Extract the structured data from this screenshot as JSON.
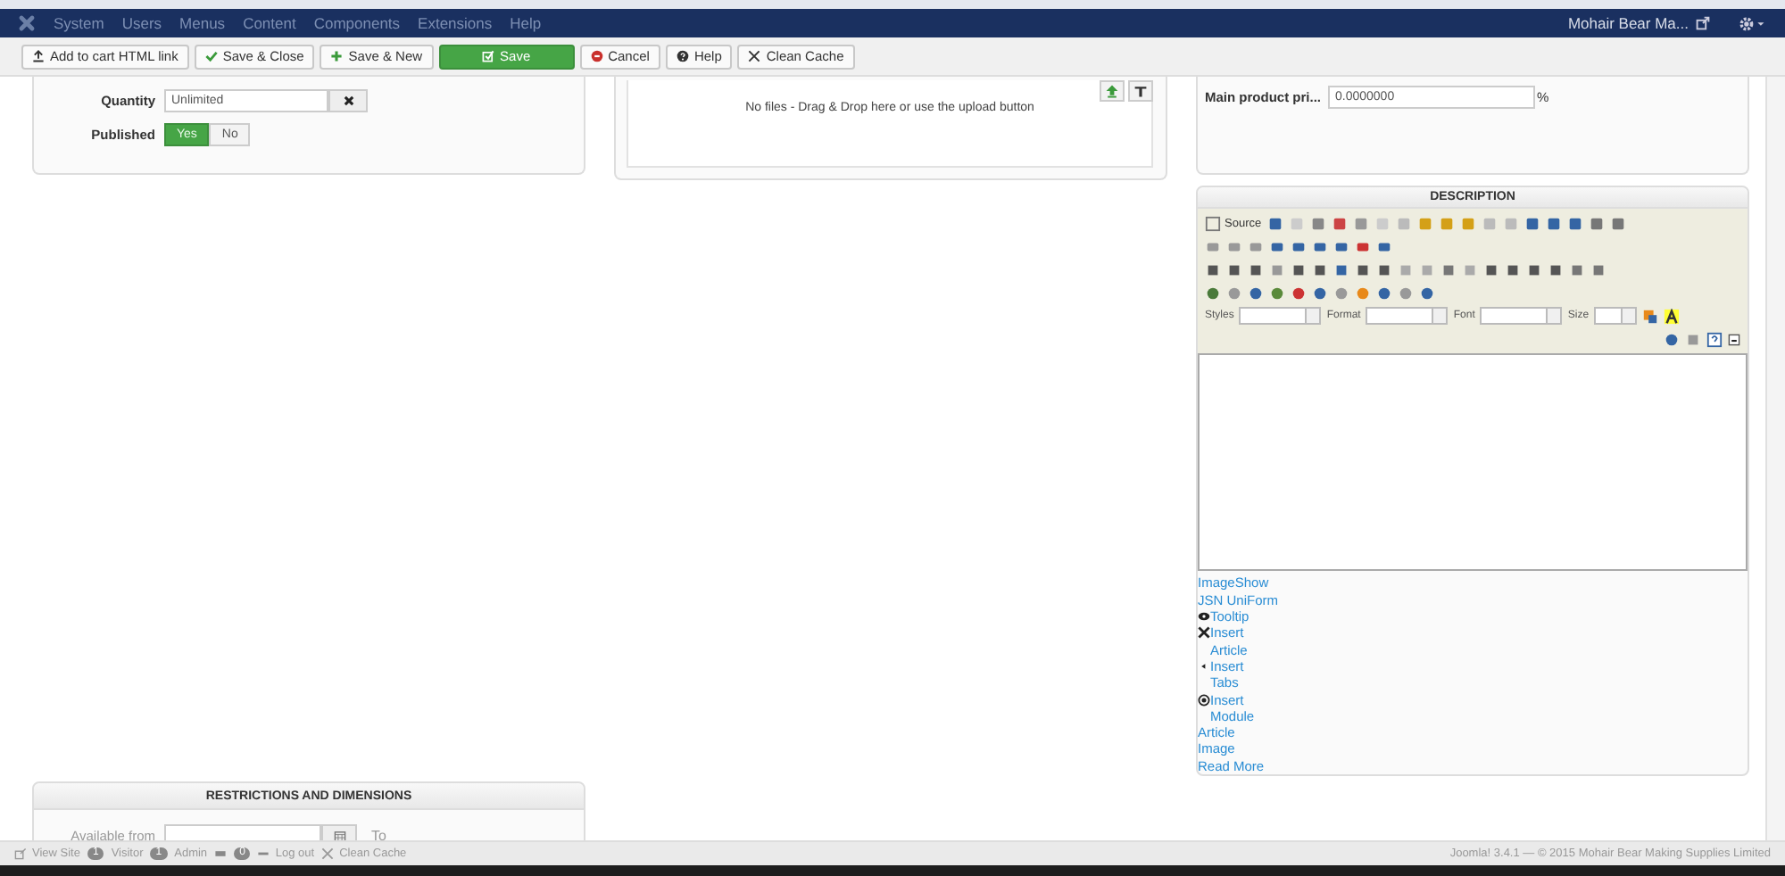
{
  "nav": {
    "menu": [
      "System",
      "Users",
      "Menus",
      "Content",
      "Components",
      "Extensions",
      "Help"
    ],
    "site": "Mohair Bear Ma..."
  },
  "toolbar": [
    {
      "label": "Add to cart HTML link",
      "kind": "upload"
    },
    {
      "label": "Save & Close",
      "kind": "check"
    },
    {
      "label": "Save & New",
      "kind": "plus"
    },
    {
      "label": "Save",
      "kind": "primary"
    },
    {
      "label": "Cancel",
      "kind": "cancel"
    },
    {
      "label": "Help",
      "kind": "help"
    },
    {
      "label": "Clean Cache",
      "kind": "clean"
    }
  ],
  "left_panel": {
    "quantity_label": "Quantity",
    "quantity_value": "Unlimited",
    "published_label": "Published",
    "published_options": [
      {
        "label": "Yes",
        "selected": true
      },
      {
        "label": "No",
        "selected": false
      }
    ]
  },
  "files_panel": {
    "message": "No files - Drag & Drop here or use the upload button"
  },
  "price_panel": {
    "label": "Main product pri...",
    "value": "0.0000000",
    "unit": "%"
  },
  "description": {
    "title": "DESCRIPTION",
    "toolbar": {
      "source": "Source",
      "styles": "Styles",
      "format": "Format",
      "font": "Font",
      "size": "Size"
    },
    "links": [
      {
        "label": "ImageShow",
        "kind": "plain"
      },
      {
        "label": "JSN UniForm",
        "kind": "plain"
      },
      {
        "label": "Tooltip",
        "kind": "eye"
      },
      {
        "label": "Insert Article",
        "kind": "cross"
      },
      {
        "label": "Insert Tabs",
        "kind": "bullet"
      },
      {
        "label": "Insert Module",
        "kind": "target"
      },
      {
        "label": "Article",
        "kind": "plain"
      },
      {
        "label": "Image",
        "kind": "plain"
      },
      {
        "label": "Read More",
        "kind": "plain"
      }
    ]
  },
  "restrictions": {
    "title": "RESTRICTIONS AND DIMENSIONS",
    "available_from": "Available from",
    "to": "To"
  },
  "status_bar": {
    "view_site": "View Site",
    "visitors": "1",
    "visitors_label": "Visitor",
    "admins": "1",
    "admins_label": "Admin",
    "messages": "0",
    "logout": "Log out",
    "clean_cache": "Clean Cache",
    "version": "Joomla! 3.4.1 — © 2015 Mohair Bear Making Supplies Limited"
  }
}
